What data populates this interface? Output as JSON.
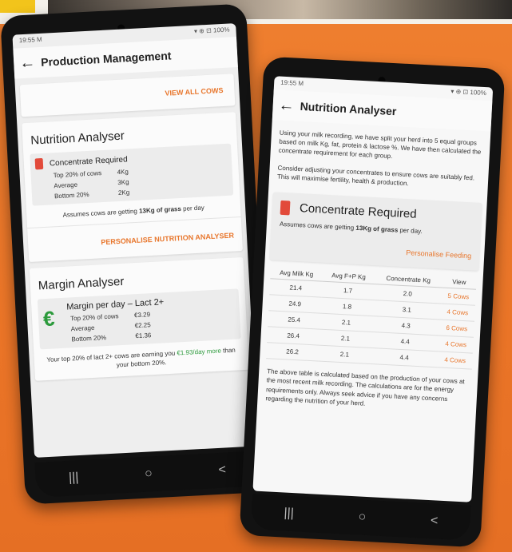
{
  "left_phone": {
    "status_time": "19:55 M",
    "status_right": "▾ ⊕ ⊡ 100%",
    "title": "Production Management",
    "view_all": "VIEW ALL COWS",
    "nutrition": {
      "heading": "Nutrition Analyser",
      "box_title": "Concentrate Required",
      "rows": [
        {
          "label": "Top 20% of cows",
          "value": "4Kg"
        },
        {
          "label": "Average",
          "value": "3Kg"
        },
        {
          "label": "Bottom 20%",
          "value": "2Kg"
        }
      ],
      "note_prefix": "Assumes cows are getting ",
      "note_bold": "13Kg of grass",
      "note_suffix": " per day",
      "button": "PERSONALISE NUTRITION ANALYSER"
    },
    "margin": {
      "heading": "Margin Analyser",
      "box_title": "Margin per day – Lact 2+",
      "currency_icon": "€",
      "rows": [
        {
          "label": "Top 20% of cows",
          "value": "€3.29"
        },
        {
          "label": "Average",
          "value": "€2.25"
        },
        {
          "label": "Bottom 20%",
          "value": "€1.36"
        }
      ],
      "note_prefix": "Your top 20% of lact 2+ cows are earning you ",
      "note_green": "€1.93/day more",
      "note_suffix": " than your bottom 20%."
    },
    "nav": [
      "|||",
      "○",
      "<"
    ]
  },
  "right_phone": {
    "status_time": "19:55 M",
    "status_right": "▾ ⊕ ⊡ 100%",
    "title": "Nutrition Analyser",
    "intro": "Using your milk recording, we have split your herd into 5 equal groups based on milk Kg, fat, protein & lactose %. We have then calculated the concentrate requirement for each group.",
    "consider": "Consider adjusting your concentrates to ensure cows are suitably fed. This will maximise fertility, health & production.",
    "concentrate_title": "Concentrate Required",
    "note_prefix": "Assumes cows are getting ",
    "note_bold": "13Kg of grass",
    "note_suffix": " per day.",
    "personalise": "Personalise Feeding",
    "table": {
      "headers": [
        "Avg Milk Kg",
        "Avg F+P Kg",
        "Concentrate Kg",
        "View"
      ],
      "rows": [
        [
          "21.4",
          "1.7",
          "2.0",
          "5 Cows"
        ],
        [
          "24.9",
          "1.8",
          "3.1",
          "4 Cows"
        ],
        [
          "25.4",
          "2.1",
          "4.3",
          "6 Cows"
        ],
        [
          "26.4",
          "2.1",
          "4.4",
          "4 Cows"
        ],
        [
          "26.2",
          "2.1",
          "4.4",
          "4 Cows"
        ]
      ]
    },
    "footer": "The above table is calculated based on the production of your cows at the most recent milk recording. The calculations are for the energy requirements only. Always seek advice if you have any concerns regarding the nutrition of your herd.",
    "nav": [
      "|||",
      "○",
      "<"
    ]
  },
  "colors": {
    "background": "#ec7a2c",
    "accent": "#e8762c",
    "green": "#2c9a3c"
  }
}
